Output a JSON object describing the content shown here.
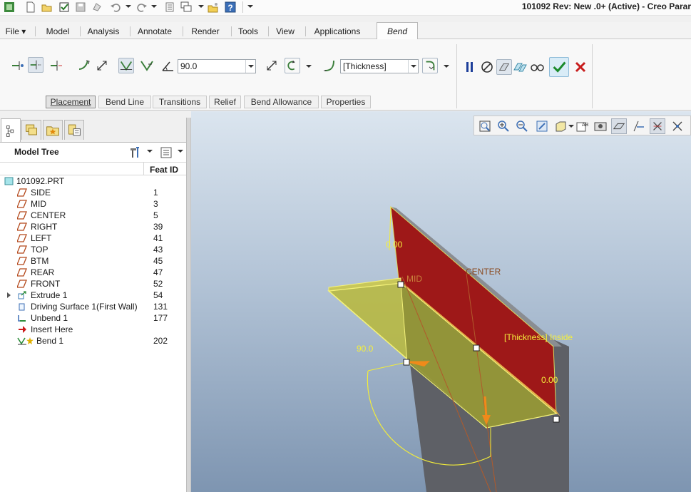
{
  "title": "101092 Rev: New .0+  (Active) - Creo Parar",
  "quick_access": {
    "icons": [
      "app-icon",
      "new-icon",
      "open-icon",
      "checkmark-icon",
      "save-icon",
      "regenerate-icon",
      "undo-icon",
      "redo-icon",
      "regen-manager-icon",
      "windows-icon",
      "close-window-icon",
      "help-icon",
      "customize-icon"
    ]
  },
  "menu_tabs": [
    "File ▾",
    "Model",
    "Analysis",
    "Annotate",
    "Render",
    "Tools",
    "View",
    "Applications",
    "Bend"
  ],
  "ribbon": {
    "angle_value": "90.0",
    "thickness_option": "[Thickness]",
    "subtabs": [
      "Placement",
      "Bend Line",
      "Transitions",
      "Relief",
      "Bend Allowance",
      "Properties"
    ]
  },
  "navigator": {
    "tab_icons": [
      "model-tree-tab-icon",
      "layers-tab-icon",
      "favorites-tab-icon",
      "folder-browser-tab-icon"
    ],
    "title": "Model Tree",
    "column_header": "Feat ID",
    "items": [
      {
        "label": "101092.PRT",
        "id": "",
        "icon": "part-icon"
      },
      {
        "label": "SIDE",
        "id": "1",
        "icon": "datum-plane-icon"
      },
      {
        "label": "MID",
        "id": "3",
        "icon": "datum-plane-icon"
      },
      {
        "label": "CENTER",
        "id": "5",
        "icon": "datum-plane-icon"
      },
      {
        "label": "RIGHT",
        "id": "39",
        "icon": "datum-plane-icon"
      },
      {
        "label": "LEFT",
        "id": "41",
        "icon": "datum-plane-icon"
      },
      {
        "label": "TOP",
        "id": "43",
        "icon": "datum-plane-icon"
      },
      {
        "label": "BTM",
        "id": "45",
        "icon": "datum-plane-icon"
      },
      {
        "label": "REAR",
        "id": "47",
        "icon": "datum-plane-icon"
      },
      {
        "label": "FRONT",
        "id": "52",
        "icon": "datum-plane-icon"
      },
      {
        "label": "Extrude 1",
        "id": "54",
        "icon": "extrude-icon"
      },
      {
        "label": "Driving Surface 1(First Wall)",
        "id": "131",
        "icon": "driving-surface-icon"
      },
      {
        "label": "Unbend 1",
        "id": "177",
        "icon": "unbend-icon"
      },
      {
        "label": "Insert Here",
        "id": "",
        "icon": "insert-arrow-icon"
      },
      {
        "label": "Bend 1",
        "id": "202",
        "icon": "bend-icon"
      }
    ]
  },
  "viewport": {
    "labels": {
      "dim_top": "0.00",
      "mid": "MID",
      "center": "CENTER",
      "thickness": "[Thickness] Inside",
      "angle": "90.0",
      "dim_right": "0.00"
    }
  }
}
